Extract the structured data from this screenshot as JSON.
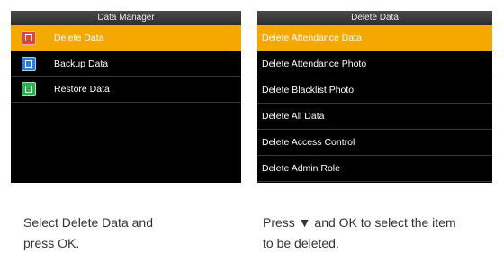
{
  "left_screen": {
    "title": "Data Manager",
    "items": [
      {
        "label": "Delete Data",
        "icon": "delete-data-icon",
        "icon_color": "#e0452f",
        "selected": true
      },
      {
        "label": "Backup Data",
        "icon": "backup-data-icon",
        "icon_color": "#2f7fd6",
        "selected": false
      },
      {
        "label": "Restore Data",
        "icon": "restore-data-icon",
        "icon_color": "#2fae4f",
        "selected": false
      }
    ]
  },
  "right_screen": {
    "title": "Delete Data",
    "items": [
      {
        "label": "Delete Attendance Data",
        "selected": true
      },
      {
        "label": "Delete Attendance Photo",
        "selected": false
      },
      {
        "label": "Delete Blacklist Photo",
        "selected": false
      },
      {
        "label": "Delete All Data",
        "selected": false
      },
      {
        "label": "Delete Access Control",
        "selected": false
      },
      {
        "label": "Delete Admin Role",
        "selected": false
      }
    ]
  },
  "captions": {
    "left": [
      "Select Delete Data and",
      "press OK."
    ],
    "right": [
      "Press ▼ and OK to select the item",
      "to be deleted."
    ]
  },
  "colors": {
    "highlight": "#f5a800",
    "screen_bg": "#000000"
  }
}
